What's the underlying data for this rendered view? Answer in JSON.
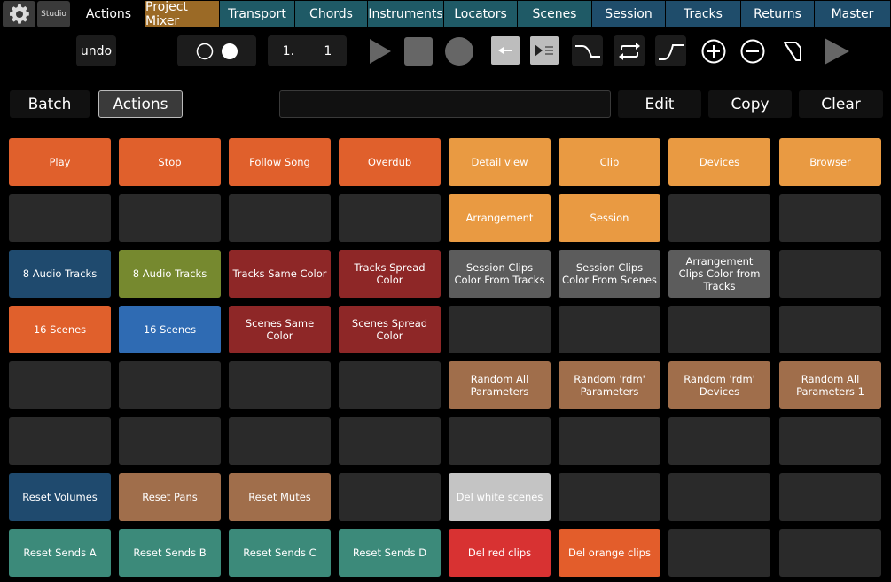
{
  "colors": {
    "orange": "#e0602c",
    "light_orange": "#e99a42",
    "empty": "#2a2a2a",
    "navy": "#1f4a6e",
    "olive": "#76892f",
    "dark_red": "#8e2727",
    "grey": "#5c5c5c",
    "blue": "#2f6bb3",
    "brown": "#a06e4b",
    "light_grey": "#c4c4c4",
    "teal": "#3c8a7a",
    "red": "#d83232",
    "orange2": "#e35d2b"
  },
  "topbar": {
    "settings_icon": "gear-icon",
    "studio": "Studio",
    "tabs": [
      {
        "label": "Actions",
        "color": "#000000"
      },
      {
        "label": "Project Mixer",
        "color": "#9b6a26"
      },
      {
        "label": "Transport",
        "color": "#1f5a66"
      },
      {
        "label": "Chords",
        "color": "#1f5a66"
      },
      {
        "label": "Instruments",
        "color": "#1f5a66"
      },
      {
        "label": "Locators",
        "color": "#1f5a66"
      },
      {
        "label": "Scenes",
        "color": "#1f5a66"
      },
      {
        "label": "Session",
        "color": "#1f4d6b"
      },
      {
        "label": "Tracks",
        "color": "#1f4d6b"
      },
      {
        "label": "Returns",
        "color": "#1f4d6b"
      },
      {
        "label": "Master",
        "color": "#1f4d6b"
      }
    ]
  },
  "toolbar": {
    "undo": "undo",
    "position_bar": "1.",
    "position_beat": "1"
  },
  "row2": {
    "batch": "Batch",
    "actions": "Actions",
    "edit": "Edit",
    "copy": "Copy",
    "clear": "Clear"
  },
  "pads": [
    [
      {
        "label": "Play",
        "color": "orange"
      },
      {
        "label": "Stop",
        "color": "orange"
      },
      {
        "label": "Follow Song",
        "color": "orange"
      },
      {
        "label": "Overdub",
        "color": "orange"
      },
      {
        "label": "Detail view",
        "color": "light_orange"
      },
      {
        "label": "Clip",
        "color": "light_orange"
      },
      {
        "label": "Devices",
        "color": "light_orange"
      },
      {
        "label": "Browser",
        "color": "light_orange"
      }
    ],
    [
      {
        "label": "",
        "color": "empty"
      },
      {
        "label": "",
        "color": "empty"
      },
      {
        "label": "",
        "color": "empty"
      },
      {
        "label": "",
        "color": "empty"
      },
      {
        "label": "Arrangement",
        "color": "light_orange"
      },
      {
        "label": "Session",
        "color": "light_orange"
      },
      {
        "label": "",
        "color": "empty"
      },
      {
        "label": "",
        "color": "empty"
      }
    ],
    [
      {
        "label": "8 Audio Tracks",
        "color": "navy"
      },
      {
        "label": "8 Audio Tracks",
        "color": "olive"
      },
      {
        "label": "Tracks Same Color",
        "color": "dark_red"
      },
      {
        "label": "Tracks Spread Color",
        "color": "dark_red"
      },
      {
        "label": "Session Clips Color From Tracks",
        "color": "grey"
      },
      {
        "label": "Session Clips Color From Scenes",
        "color": "grey"
      },
      {
        "label": "Arrangement Clips Color from Tracks",
        "color": "grey"
      },
      {
        "label": "",
        "color": "empty"
      }
    ],
    [
      {
        "label": "16 Scenes",
        "color": "orange"
      },
      {
        "label": "16 Scenes",
        "color": "blue"
      },
      {
        "label": "Scenes Same Color",
        "color": "dark_red"
      },
      {
        "label": "Scenes Spread Color",
        "color": "dark_red"
      },
      {
        "label": "",
        "color": "empty"
      },
      {
        "label": "",
        "color": "empty"
      },
      {
        "label": "",
        "color": "empty"
      },
      {
        "label": "",
        "color": "empty"
      }
    ],
    [
      {
        "label": "",
        "color": "empty"
      },
      {
        "label": "",
        "color": "empty"
      },
      {
        "label": "",
        "color": "empty"
      },
      {
        "label": "",
        "color": "empty"
      },
      {
        "label": "Random All Parameters",
        "color": "brown"
      },
      {
        "label": "Random 'rdm' Parameters",
        "color": "brown"
      },
      {
        "label": "Random 'rdm' Devices",
        "color": "brown"
      },
      {
        "label": "Random All Parameters 1",
        "color": "brown"
      }
    ],
    [
      {
        "label": "",
        "color": "empty"
      },
      {
        "label": "",
        "color": "empty"
      },
      {
        "label": "",
        "color": "empty"
      },
      {
        "label": "",
        "color": "empty"
      },
      {
        "label": "",
        "color": "empty"
      },
      {
        "label": "",
        "color": "empty"
      },
      {
        "label": "",
        "color": "empty"
      },
      {
        "label": "",
        "color": "empty"
      }
    ],
    [
      {
        "label": "Reset Volumes",
        "color": "navy"
      },
      {
        "label": "Reset Pans",
        "color": "brown"
      },
      {
        "label": "Reset Mutes",
        "color": "brown"
      },
      {
        "label": "",
        "color": "empty"
      },
      {
        "label": "Del white scenes",
        "color": "light_grey"
      },
      {
        "label": "",
        "color": "empty"
      },
      {
        "label": "",
        "color": "empty"
      },
      {
        "label": "",
        "color": "empty"
      }
    ],
    [
      {
        "label": "Reset Sends A",
        "color": "teal"
      },
      {
        "label": "Reset Sends B",
        "color": "teal"
      },
      {
        "label": "Reset Sends C",
        "color": "teal"
      },
      {
        "label": "Reset Sends D",
        "color": "teal"
      },
      {
        "label": "Del red clips",
        "color": "red"
      },
      {
        "label": "Del orange clips",
        "color": "orange2"
      },
      {
        "label": "",
        "color": "empty"
      },
      {
        "label": "",
        "color": "empty"
      }
    ]
  ]
}
